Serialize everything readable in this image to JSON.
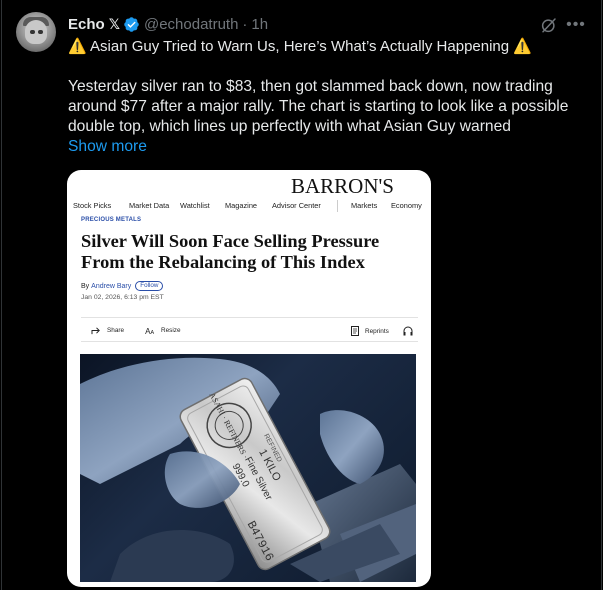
{
  "post": {
    "display_name": "Echo",
    "x_badge": "𝕏",
    "handle": "@echodatruth",
    "separator": "·",
    "time": "1h",
    "title_warning_icon": "⚠️",
    "title": "Asian Guy Tried to Warn Us, Here’s What’s Actually Happening",
    "body": "Yesterday silver ran to $83, then got slammed back down, now trading around $77 after a major rally. The chart is starting to look like a possible double top, which lines up perfectly with what Asian Guy warned",
    "show_more": "Show more"
  },
  "article": {
    "logo": "BARRON'S",
    "nav": [
      "Stock Picks",
      "Market Data",
      "Watchlist",
      "Magazine",
      "Advisor Center",
      "Markets",
      "Economy"
    ],
    "category": "PRECIOUS METALS",
    "headline": "Silver Will Soon Face Selling Pressure From the Rebalancing of This Index",
    "by_prefix": "By",
    "author": "Andrew Bary",
    "follow_label": "Follow",
    "date": "Jan 02, 2026, 6:13 pm EST",
    "share_label": "Share",
    "resize_label": "Resize",
    "reprints_label": "Reprints",
    "bar_text": {
      "seal": "ASAHI · REFINERS ·",
      "line1": "1 KILO",
      "line2": "Fine Silver",
      "line3": "999.0",
      "serial": "B47916",
      "edge": "REFINED"
    }
  },
  "colors": {
    "background": "#000000",
    "accent_blue": "#1d9bf0",
    "muted": "#71767b",
    "warning": "#f4c430"
  },
  "icons": [
    "verified-badge-icon",
    "grok-icon",
    "more-icon",
    "warning-icon",
    "share-icon",
    "resize-icon",
    "reprints-icon",
    "audio-icon"
  ]
}
